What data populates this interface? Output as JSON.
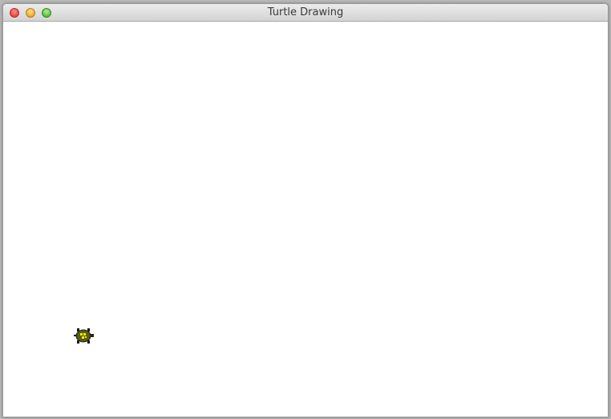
{
  "window": {
    "title": "Turtle Drawing"
  },
  "canvas": {
    "background": "#ffffff",
    "turtle_icon": "turtle-icon",
    "turtle_colors": {
      "shell": "#5a5a14",
      "shell_highlight": "#f2f200",
      "limbs": "#1a1a1a"
    }
  },
  "controls": {
    "close": "close-button",
    "minimize": "minimize-button",
    "zoom": "zoom-button"
  }
}
